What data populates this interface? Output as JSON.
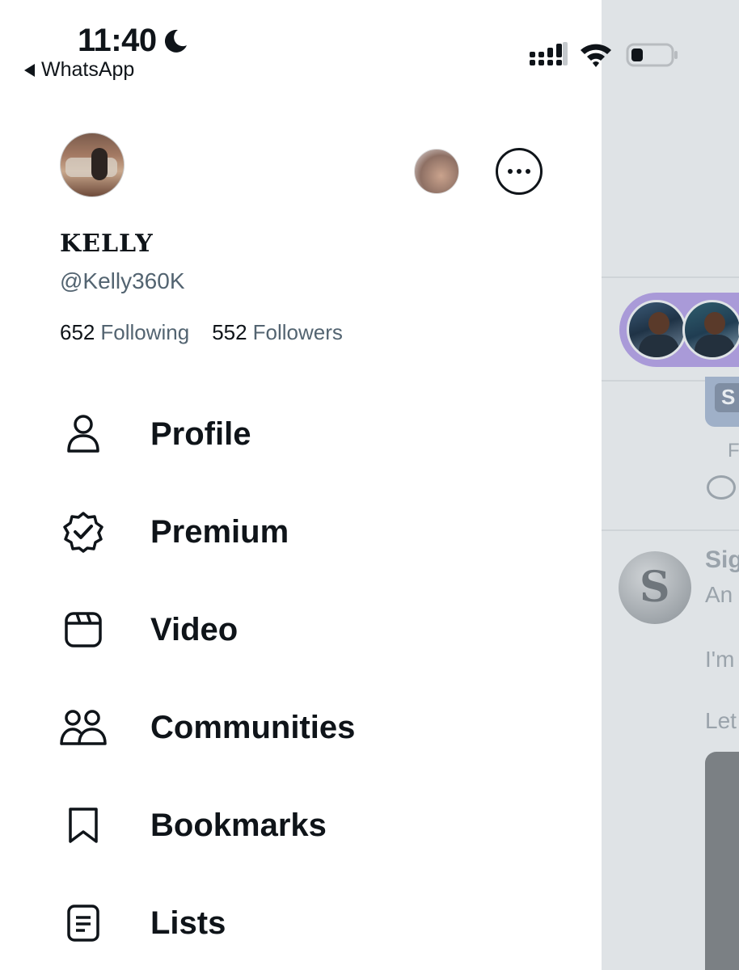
{
  "status_bar": {
    "time": "11:40",
    "back_app": "WhatsApp",
    "icons": [
      "moon-icon",
      "signal-icon",
      "wifi-icon",
      "battery-icon"
    ]
  },
  "profile": {
    "display_name": "KELLY",
    "handle": "@Kelly360K",
    "following_count": "652",
    "following_label": "Following",
    "followers_count": "552",
    "followers_label": "Followers"
  },
  "menu": [
    {
      "label": "Profile",
      "icon": "person-icon"
    },
    {
      "label": "Premium",
      "icon": "verified-badge-icon"
    },
    {
      "label": "Video",
      "icon": "video-icon"
    },
    {
      "label": "Communities",
      "icon": "communities-icon"
    },
    {
      "label": "Bookmarks",
      "icon": "bookmark-icon"
    },
    {
      "label": "Lists",
      "icon": "list-icon"
    }
  ],
  "background_timeline": {
    "card_tag": "S",
    "faint_letter": "F",
    "post_author": "Sig",
    "post_sub": "An",
    "post_line_1": "I'm",
    "post_line_2": "Let"
  },
  "colors": {
    "text_primary": "#0f1419",
    "text_secondary": "#536471",
    "drawer_bg": "#ffffff",
    "backdrop": "#dfe3e6",
    "spaces_accent": "#a99ad8"
  }
}
